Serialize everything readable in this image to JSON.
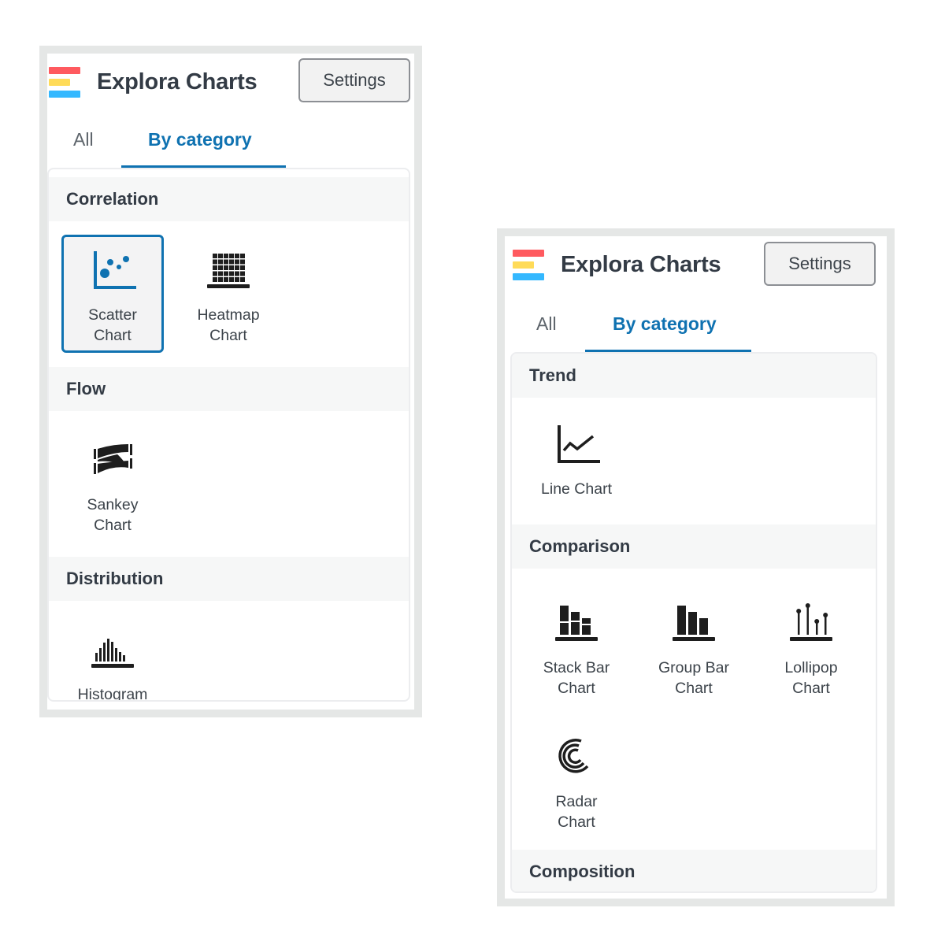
{
  "panels": [
    {
      "app_title": "Explora Charts",
      "settings_label": "Settings",
      "tabs": [
        {
          "label": "All",
          "active": false
        },
        {
          "label": "By category",
          "active": true
        }
      ],
      "sections": [
        {
          "name": "Correlation",
          "items": [
            {
              "label_line1": "Scatter",
              "label_line2": "Chart",
              "icon": "scatter-chart-icon",
              "selected": true
            },
            {
              "label_line1": "Heatmap",
              "label_line2": "Chart",
              "icon": "heatmap-chart-icon",
              "selected": false
            }
          ]
        },
        {
          "name": "Flow",
          "items": [
            {
              "label_line1": "Sankey",
              "label_line2": "Chart",
              "icon": "sankey-chart-icon",
              "selected": false
            }
          ]
        },
        {
          "name": "Distribution",
          "items": [
            {
              "label_line1": "Histogram",
              "label_line2": "",
              "icon": "histogram-icon",
              "selected": false
            }
          ]
        }
      ]
    },
    {
      "app_title": "Explora Charts",
      "settings_label": "Settings",
      "tabs": [
        {
          "label": "All",
          "active": false
        },
        {
          "label": "By category",
          "active": true
        }
      ],
      "sections": [
        {
          "name": "Trend",
          "items": [
            {
              "label_line1": "Line Chart",
              "label_line2": "",
              "icon": "line-chart-icon",
              "selected": false
            }
          ]
        },
        {
          "name": "Comparison",
          "items": [
            {
              "label_line1": "Stack Bar",
              "label_line2": "Chart",
              "icon": "stack-bar-chart-icon",
              "selected": false
            },
            {
              "label_line1": "Group Bar",
              "label_line2": "Chart",
              "icon": "group-bar-chart-icon",
              "selected": false
            },
            {
              "label_line1": "Lollipop",
              "label_line2": "Chart",
              "icon": "lollipop-chart-icon",
              "selected": false
            },
            {
              "label_line1": "Radar",
              "label_line2": "Chart",
              "icon": "radar-chart-icon",
              "selected": false
            }
          ]
        },
        {
          "name": "Composition",
          "items": []
        }
      ]
    }
  ],
  "colors": {
    "accent": "#0f72b1",
    "logo_red": "#ff5a5f",
    "logo_yellow": "#ffdb58",
    "logo_blue": "#34b8ff",
    "frame": "#e5e7e6",
    "section_bg": "#f6f7f7",
    "text_dark": "#333b45"
  }
}
